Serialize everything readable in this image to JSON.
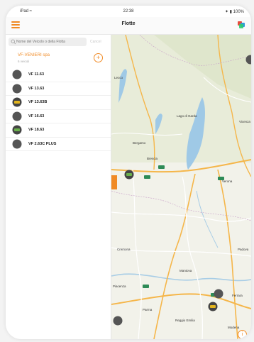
{
  "status_bar": {
    "left": "iPad ≈",
    "time": "22:38",
    "right": "✦ ▮ 100%"
  },
  "nav": {
    "title": "Flotte"
  },
  "search": {
    "placeholder": "Nome del Veicolo o della Flotta",
    "cancel_label": "Cancel"
  },
  "company": {
    "name": "VF-VENIERI spa",
    "subtitle": "6 veicoli",
    "add_label": "+"
  },
  "vehicles": [
    {
      "label": "VF 11.63",
      "status": "offline"
    },
    {
      "label": "VF 13.63",
      "status": "offline"
    },
    {
      "label": "VF 13.63B",
      "status": "idle"
    },
    {
      "label": "VF 16.63",
      "status": "offline"
    },
    {
      "label": "VF 18.63",
      "status": "moving"
    },
    {
      "label": "VF 2.63C PLUS",
      "status": "offline"
    }
  ],
  "status_colors": {
    "offline": "#555555",
    "idle": "#e3b51e",
    "moving": "#6ab04c"
  },
  "accent_color": "#f08a24",
  "map": {
    "labels": [
      {
        "text": "Lecco"
      },
      {
        "text": "Bergamo"
      },
      {
        "text": "Brescia"
      },
      {
        "text": "Lago di Garda"
      },
      {
        "text": "Verona"
      },
      {
        "text": "Vicenza"
      },
      {
        "text": "Padova"
      },
      {
        "text": "Cremona"
      },
      {
        "text": "Mantova"
      },
      {
        "text": "Parma"
      },
      {
        "text": "Modena"
      },
      {
        "text": "Reggio Emilia"
      },
      {
        "text": "Piacenza"
      },
      {
        "text": "Ferrara"
      }
    ],
    "info_label": "i"
  }
}
